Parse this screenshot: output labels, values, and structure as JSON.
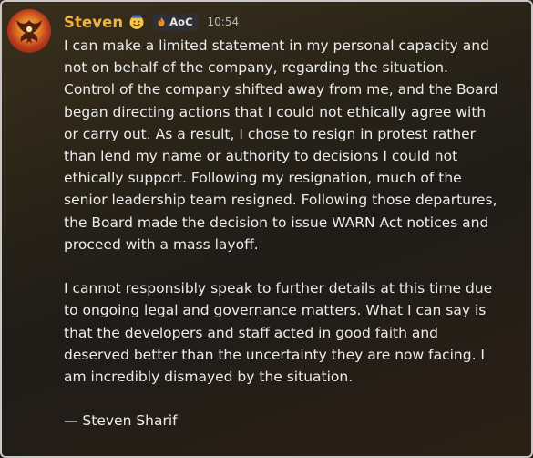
{
  "message": {
    "author": "Steven",
    "tag": "AoC",
    "timestamp": "10:54",
    "paragraph1_lines": [
      "I can make a limited statement in my personal capacity and",
      "not on behalf of the company, regarding the situation.",
      "Control of the company shifted away from me, and the Board",
      "began directing actions that I could not ethically agree with",
      "or carry out. As a result, I chose to resign in protest rather",
      "than lend my name or authority to decisions I could not",
      "ethically support. Following my resignation, much of the",
      "senior leadership team resigned. Following those departures,",
      "the Board made the decision to issue WARN Act notices and",
      "proceed with a mass layoff."
    ],
    "paragraph2_lines": [
      "I cannot responsibly speak to further details at this time due",
      "to ongoing legal and governance matters. What I can say is",
      "that the developers and staff acted in good faith and",
      "deserved better than the uncertainty they are now facing. I",
      "am incredibly dismayed by the situation."
    ],
    "signature": "— Steven Sharif"
  },
  "colors": {
    "username": "#f3b13f",
    "text": "#ececec",
    "timestamp": "#b5b8bd",
    "tag_bg": "#2e3035"
  },
  "icons": {
    "avatar": "phoenix-avatar",
    "badge": "smiling-face-emoji-icon",
    "tag_icon": "flame-icon"
  }
}
